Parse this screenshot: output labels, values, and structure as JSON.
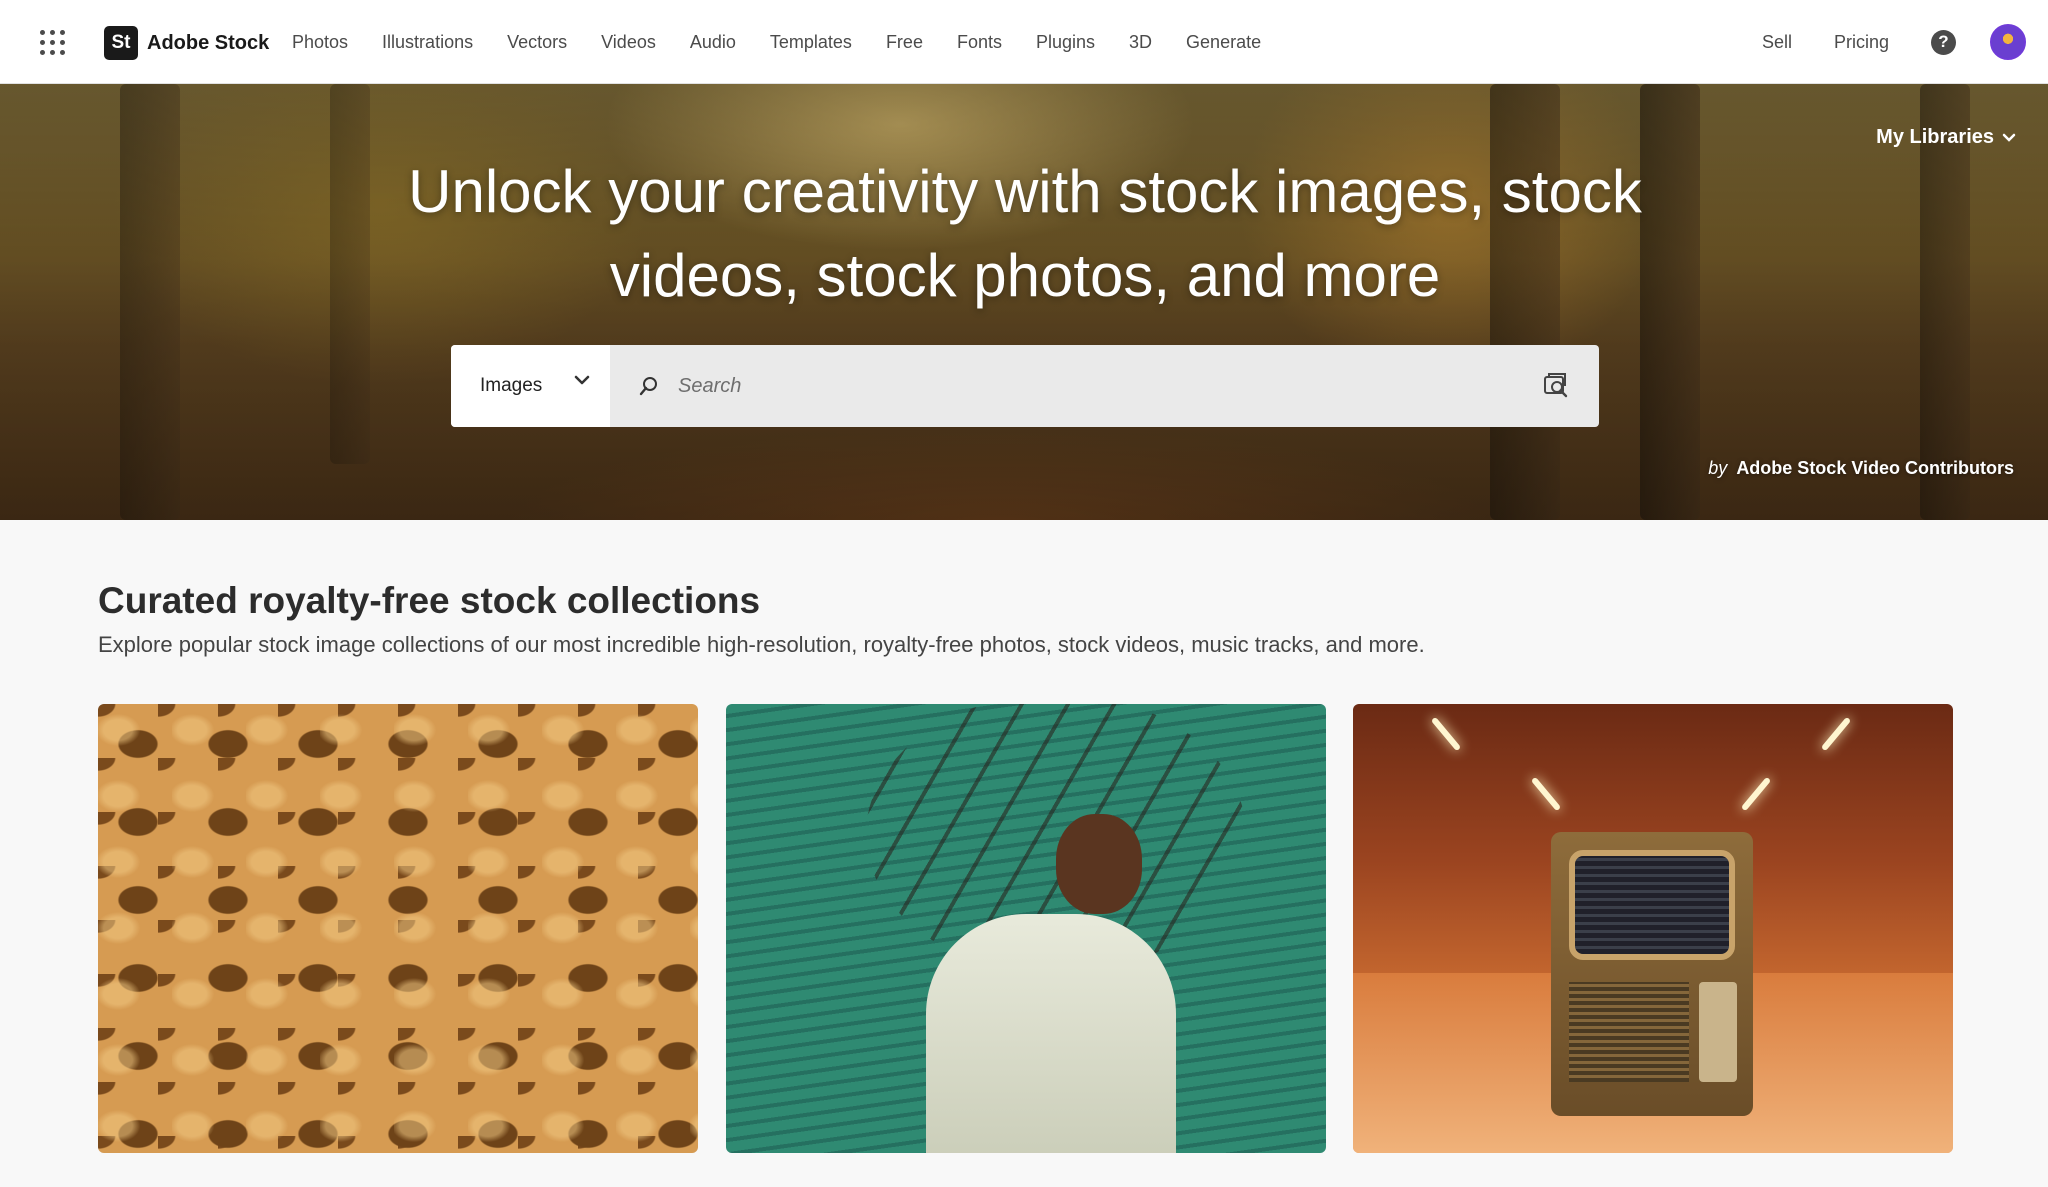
{
  "brand": {
    "logo_text": "St",
    "name": "Adobe Stock"
  },
  "nav": {
    "items": [
      {
        "label": "Photos"
      },
      {
        "label": "Illustrations"
      },
      {
        "label": "Vectors"
      },
      {
        "label": "Videos"
      },
      {
        "label": "Audio"
      },
      {
        "label": "Templates"
      },
      {
        "label": "Free"
      },
      {
        "label": "Fonts"
      },
      {
        "label": "Plugins"
      },
      {
        "label": "3D"
      },
      {
        "label": "Generate"
      }
    ],
    "right": {
      "sell": "Sell",
      "pricing": "Pricing",
      "help": "?"
    }
  },
  "hero": {
    "my_libraries": "My Libraries",
    "title": "Unlock your creativity with stock images, stock videos, stock photos, and more",
    "search": {
      "type_selected": "Images",
      "placeholder": "Search"
    },
    "credit_prefix": "by",
    "credit_name": "Adobe Stock Video Contributors"
  },
  "collections": {
    "title": "Curated royalty-free stock collections",
    "subtitle": "Explore popular stock image collections of our most incredible high-resolution, royalty-free photos, stock videos, music tracks, and more."
  },
  "icons": {
    "app_switcher": "app-grid-icon",
    "help": "help-icon",
    "search": "search-icon",
    "visual_search": "visual-search-icon",
    "chevron": "chevron-down-icon"
  },
  "colors": {
    "topbar_bg": "#ffffff",
    "page_bg": "#f8f8f8",
    "brand_logo_bg": "#1a1a1a",
    "avatar_accent": "#6f3bd8"
  }
}
